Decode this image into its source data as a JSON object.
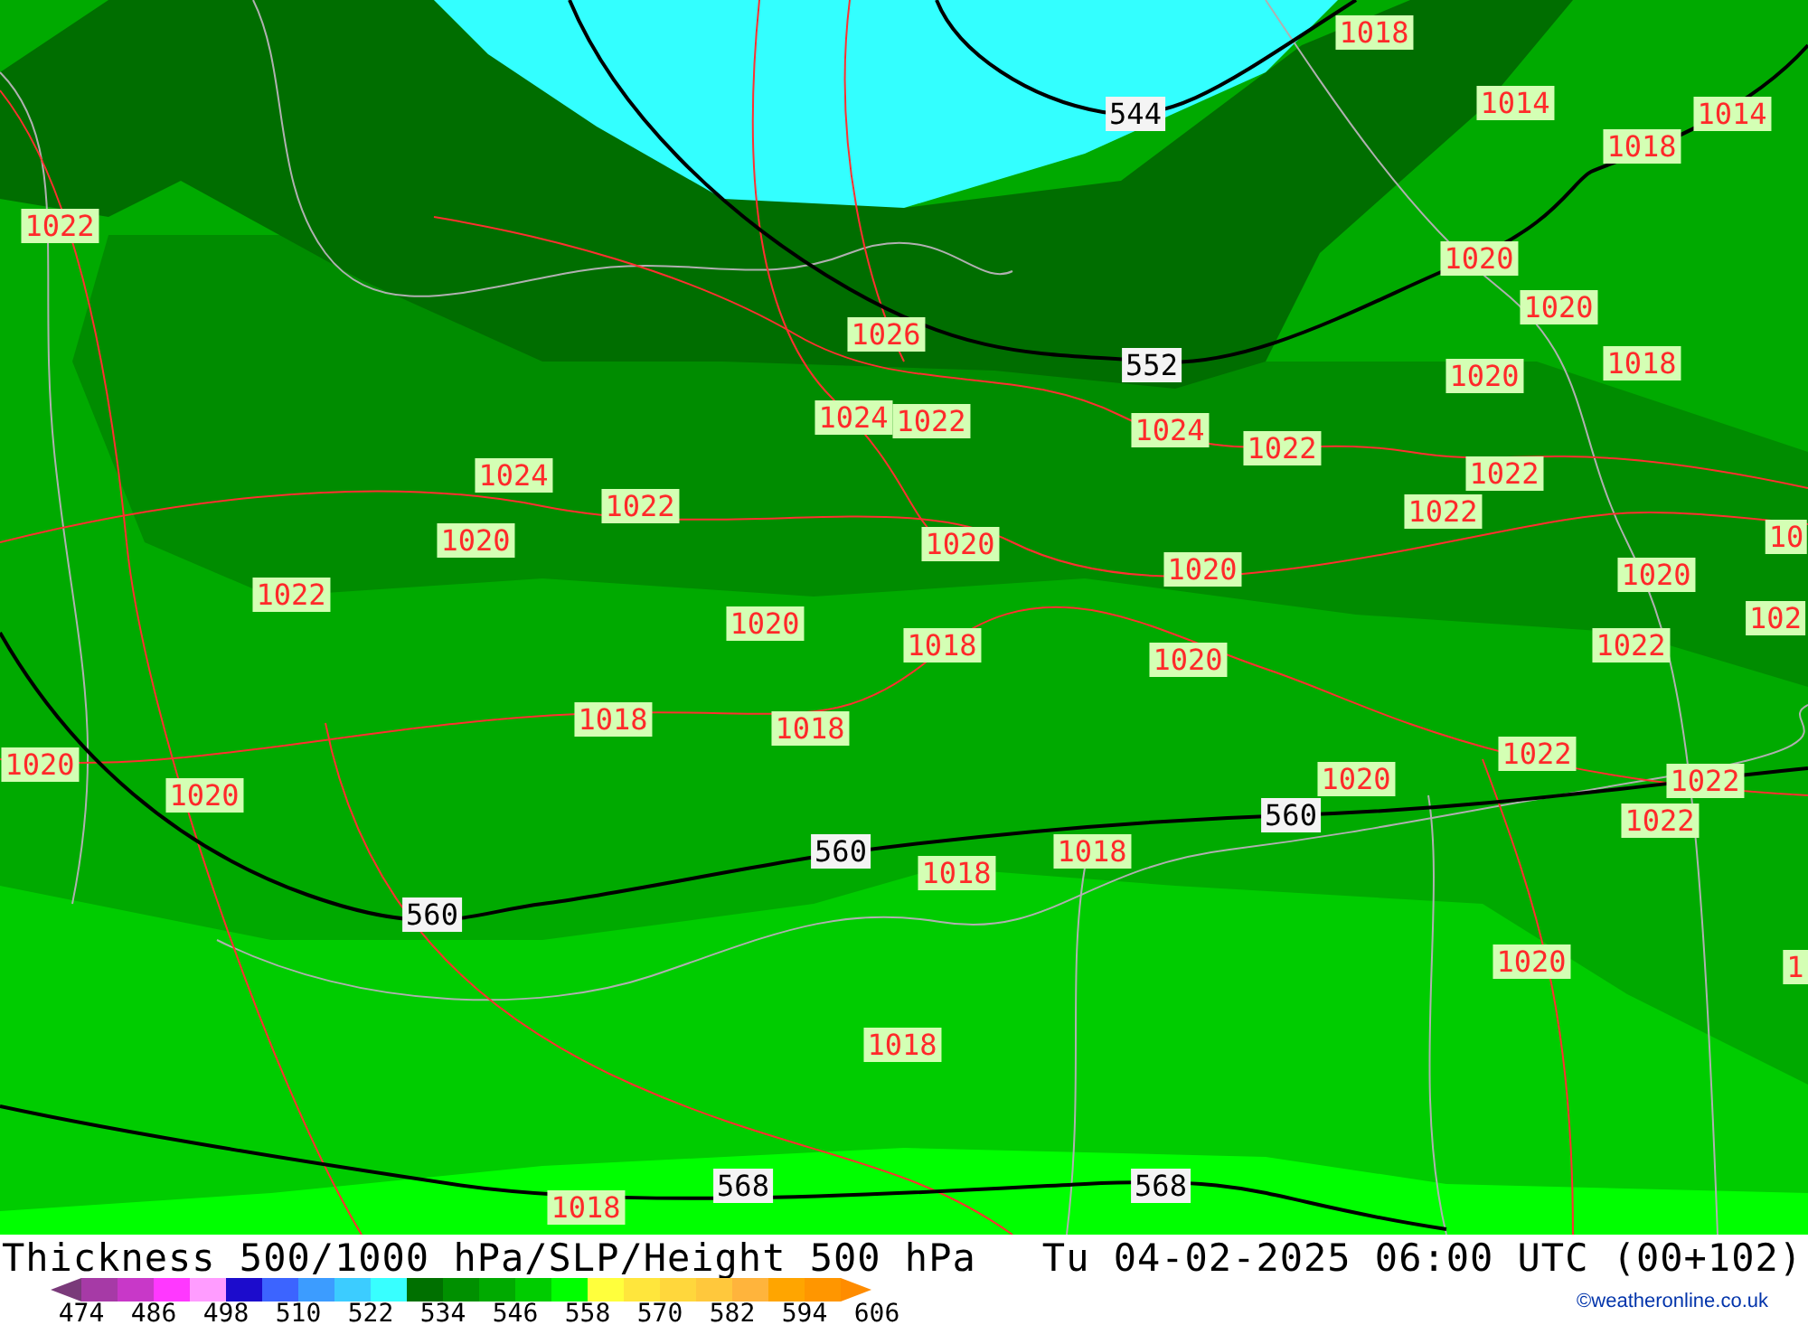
{
  "map": {
    "pressure_labels": [
      "1018",
      "1014",
      "1014",
      "1018",
      "1022",
      "1020",
      "1020",
      "1026",
      "1018",
      "1020",
      "1024",
      "1022",
      "1024",
      "1022",
      "1024",
      "1022",
      "1022",
      "1022",
      "1020",
      "1020",
      "10",
      "1020",
      "1020",
      "1022",
      "102",
      "1020",
      "1018",
      "1022",
      "1020",
      "1018",
      "1018",
      "1022",
      "1020",
      "1020",
      "1022",
      "1020",
      "1022",
      "1018",
      "1018",
      "1020",
      "1",
      "1018",
      "1018"
    ],
    "thickness_labels": [
      "544",
      "552",
      "560",
      "560",
      "560",
      "568",
      "568"
    ]
  },
  "title": "Thickness 500/1000 hPa/SLP/Height 500 hPa",
  "valid_time": "Tu 04-02-2025 06:00 UTC (00+102)",
  "legend": {
    "swatches": [
      {
        "kind": "start",
        "color": "#7a3a7a"
      },
      {
        "kind": "band",
        "color": "#a63aa6"
      },
      {
        "kind": "band",
        "color": "#c838c8"
      },
      {
        "kind": "band",
        "color": "#ff38ff"
      },
      {
        "kind": "band",
        "color": "#ff9cff"
      },
      {
        "kind": "band",
        "color": "#1c0ccc"
      },
      {
        "kind": "band",
        "color": "#3c64ff"
      },
      {
        "kind": "band",
        "color": "#3c9cff"
      },
      {
        "kind": "band",
        "color": "#3cccff"
      },
      {
        "kind": "band",
        "color": "#38ffff"
      },
      {
        "kind": "band",
        "color": "#007000"
      },
      {
        "kind": "band",
        "color": "#009000"
      },
      {
        "kind": "band",
        "color": "#00aa00"
      },
      {
        "kind": "band",
        "color": "#00cc00"
      },
      {
        "kind": "band",
        "color": "#00ff00"
      },
      {
        "kind": "band",
        "color": "#ffff3c"
      },
      {
        "kind": "band",
        "color": "#ffe63c"
      },
      {
        "kind": "band",
        "color": "#ffd73c"
      },
      {
        "kind": "band",
        "color": "#ffc83c"
      },
      {
        "kind": "band",
        "color": "#ffb43c"
      },
      {
        "kind": "band",
        "color": "#ffa500"
      },
      {
        "kind": "band",
        "color": "#ff9600"
      },
      {
        "kind": "end",
        "color": "#ff8c00"
      }
    ],
    "ticks": [
      "474",
      "486",
      "498",
      "510",
      "522",
      "534",
      "546",
      "558",
      "570",
      "582",
      "594",
      "606"
    ]
  },
  "credit": "©weatheronline.co.uk"
}
